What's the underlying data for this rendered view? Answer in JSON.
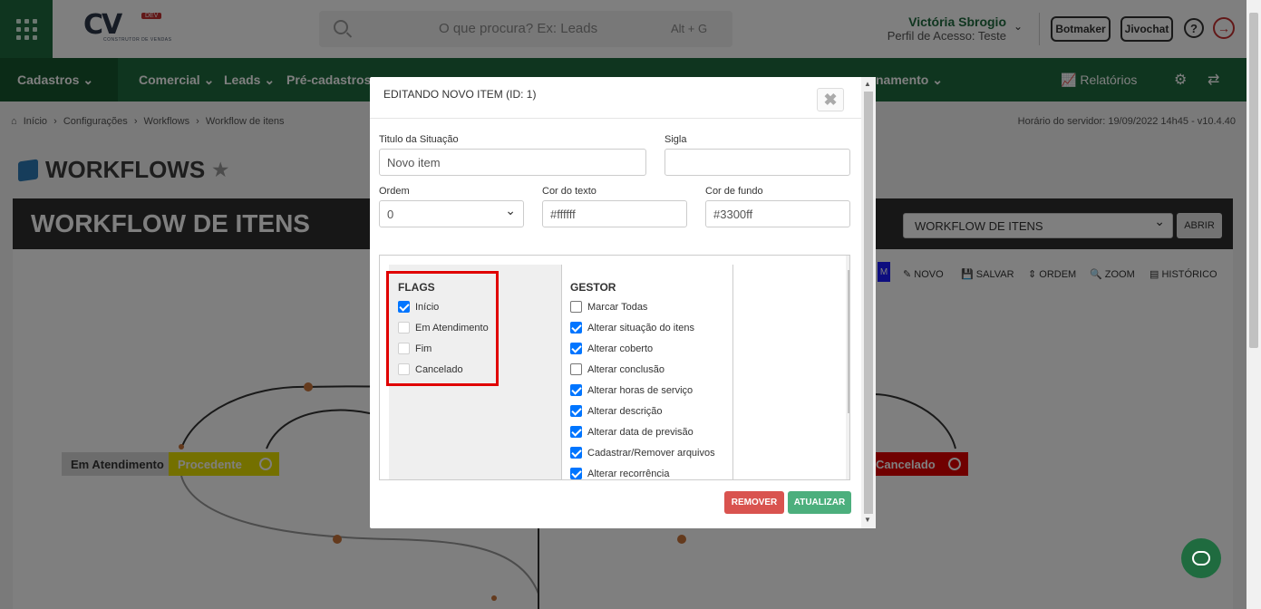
{
  "header": {
    "logo_text": "CV",
    "logo_badge": "DEV",
    "logo_sub": "CONSTRUTOR DE VENDAS",
    "search_placeholder": "O que procura? Ex: Leads",
    "search_shortcut": "Alt + G",
    "user_name": "Victória Sbrogio",
    "user_profile": "Perfil de Acesso: Teste",
    "botmaker": "Botmaker",
    "jivochat": "Jivochat",
    "help": "?"
  },
  "nav": {
    "items": [
      "Cadastros",
      "Comercial",
      "Leads",
      "Pré-cadastros",
      "namento"
    ],
    "relatorios": "Relatórios"
  },
  "breadcrumb": [
    "Início",
    "Configurações",
    "Workflows",
    "Workflow de itens"
  ],
  "server_time": "Horário do servidor: 19/09/2022 14h45 - v10.4.40",
  "page_title": "WORKFLOWS",
  "card": {
    "title": "WORKFLOW DE ITENS",
    "select_value": "WORKFLOW DE ITENS",
    "abrir": "ABRIR",
    "tools": [
      "M",
      "NOVO",
      "SALVAR",
      "ORDEM",
      "ZOOM",
      "HISTÓRICO"
    ],
    "nodes": [
      "Em Atendimento",
      "Procedente",
      "Cancelado"
    ]
  },
  "modal": {
    "title": "EDITANDO NOVO ITEM (ID: 1)",
    "close": "✖",
    "fields": {
      "titulo_label": "Titulo da Situação",
      "titulo_value": "Novo item",
      "sigla_label": "Sigla",
      "sigla_value": "",
      "ordem_label": "Ordem",
      "ordem_value": "0",
      "cor_texto_label": "Cor do texto",
      "cor_texto_value": "#ffffff",
      "cor_fundo_label": "Cor de fundo",
      "cor_fundo_value": "#3300ff"
    },
    "flags": {
      "title": "FLAGS",
      "items": [
        {
          "label": "Início",
          "checked": true
        },
        {
          "label": "Em Atendimento",
          "checked": false
        },
        {
          "label": "Fim",
          "checked": false
        },
        {
          "label": "Cancelado",
          "checked": false
        }
      ]
    },
    "gestor": {
      "title": "GESTOR",
      "items": [
        {
          "label": "Marcar Todas",
          "checked": false
        },
        {
          "label": "Alterar situação do itens",
          "checked": true
        },
        {
          "label": "Alterar coberto",
          "checked": true
        },
        {
          "label": "Alterar conclusão",
          "checked": false
        },
        {
          "label": "Alterar horas de serviço",
          "checked": true
        },
        {
          "label": "Alterar descrição",
          "checked": true
        },
        {
          "label": "Alterar data de previsão",
          "checked": true
        },
        {
          "label": "Cadastrar/Remover arquivos",
          "checked": true
        },
        {
          "label": "Alterar recorrência",
          "checked": true
        }
      ]
    },
    "remove_label": "REMOVER",
    "update_label": "ATUALIZAR"
  },
  "colors": {
    "brand_green": "#1f6b3f",
    "remove": "#d9534f",
    "update": "#4caf7d",
    "highlight": "#e00000"
  }
}
